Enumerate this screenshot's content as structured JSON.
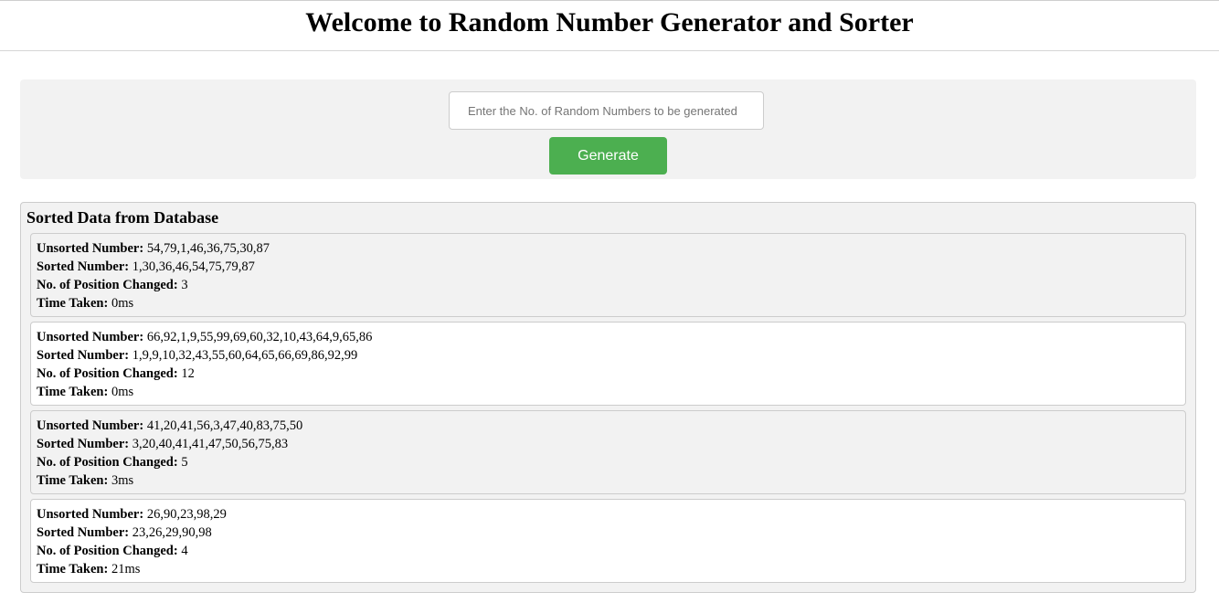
{
  "header": {
    "title": "Welcome to Random Number Generator and Sorter"
  },
  "generator": {
    "placeholder": "Enter the No. of Random Numbers to be generated",
    "button_label": "Generate"
  },
  "results": {
    "title": "Sorted Data from Database",
    "labels": {
      "unsorted": "Unsorted Number:",
      "sorted": "Sorted Number:",
      "positions": "No. of Position Changed:",
      "time": "Time Taken:"
    },
    "records": [
      {
        "unsorted": "54,79,1,46,36,75,30,87",
        "sorted": "1,30,36,46,54,75,79,87",
        "positions": "3",
        "time": "0ms"
      },
      {
        "unsorted": "66,92,1,9,55,99,69,60,32,10,43,64,9,65,86",
        "sorted": "1,9,9,10,32,43,55,60,64,65,66,69,86,92,99",
        "positions": "12",
        "time": "0ms"
      },
      {
        "unsorted": "41,20,41,56,3,47,40,83,75,50",
        "sorted": "3,20,40,41,41,47,50,56,75,83",
        "positions": "5",
        "time": "3ms"
      },
      {
        "unsorted": "26,90,23,98,29",
        "sorted": "23,26,29,90,98",
        "positions": "4",
        "time": "21ms"
      }
    ]
  }
}
